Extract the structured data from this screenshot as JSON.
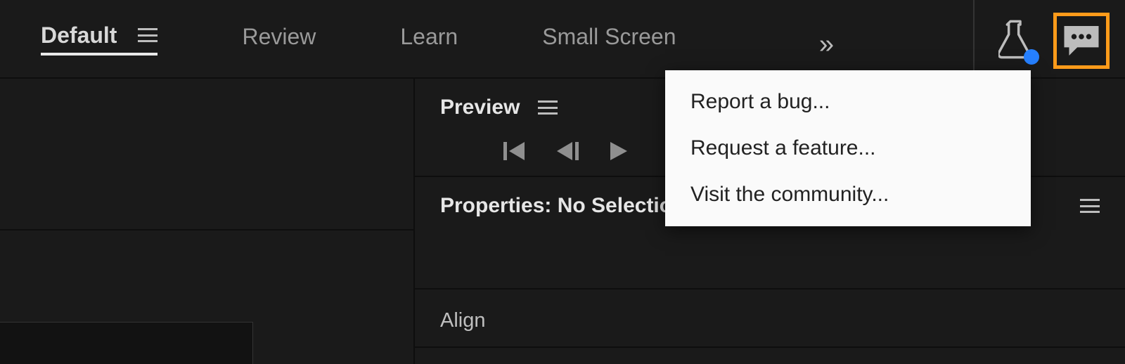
{
  "workspaces": {
    "items": [
      {
        "label": "Default",
        "active": true,
        "has_menu": true
      },
      {
        "label": "Review",
        "active": false,
        "has_menu": false
      },
      {
        "label": "Learn",
        "active": false,
        "has_menu": false
      },
      {
        "label": "Small Screen",
        "active": false,
        "has_menu": false
      }
    ]
  },
  "topbar": {
    "overflow_glyph": "»",
    "beaker_has_notification": true
  },
  "feedback_menu": {
    "items": [
      "Report a bug...",
      "Request a feature...",
      "Visit the community..."
    ]
  },
  "panels": {
    "preview": {
      "title": "Preview"
    },
    "properties": {
      "title": "Properties: No Selection"
    },
    "align": {
      "title": "Align"
    }
  }
}
